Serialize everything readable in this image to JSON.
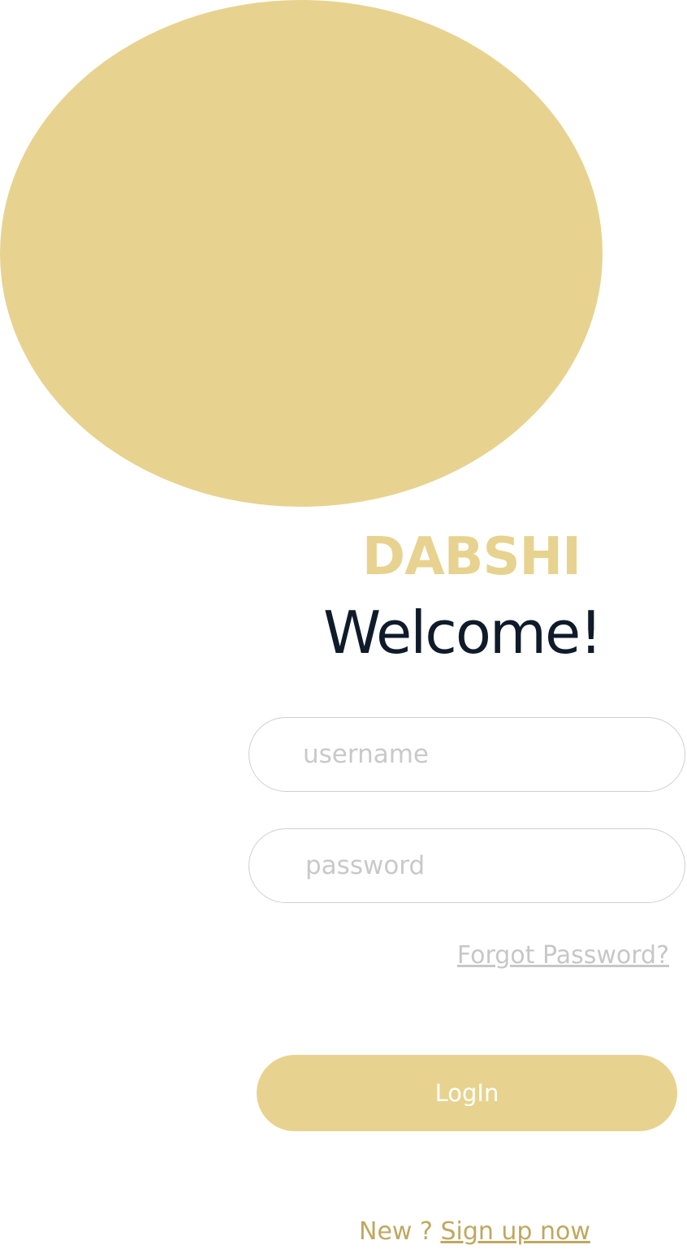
{
  "brand": {
    "name": "DABSHI",
    "color": "#e7d38f"
  },
  "welcome": {
    "title": "Welcome!",
    "color": "#0f1b2a"
  },
  "form": {
    "username_placeholder": "username",
    "password_placeholder": "password",
    "forgot_password": "Forgot Password?",
    "forgot_color": "#c7c7c7",
    "login_label": "LogIn",
    "login_bg": "#e7d38f"
  },
  "signup": {
    "prompt": "New ? ",
    "link": "Sign up now",
    "color": "#bfa85f"
  },
  "decor": {
    "blob_color": "#e7d38f"
  }
}
